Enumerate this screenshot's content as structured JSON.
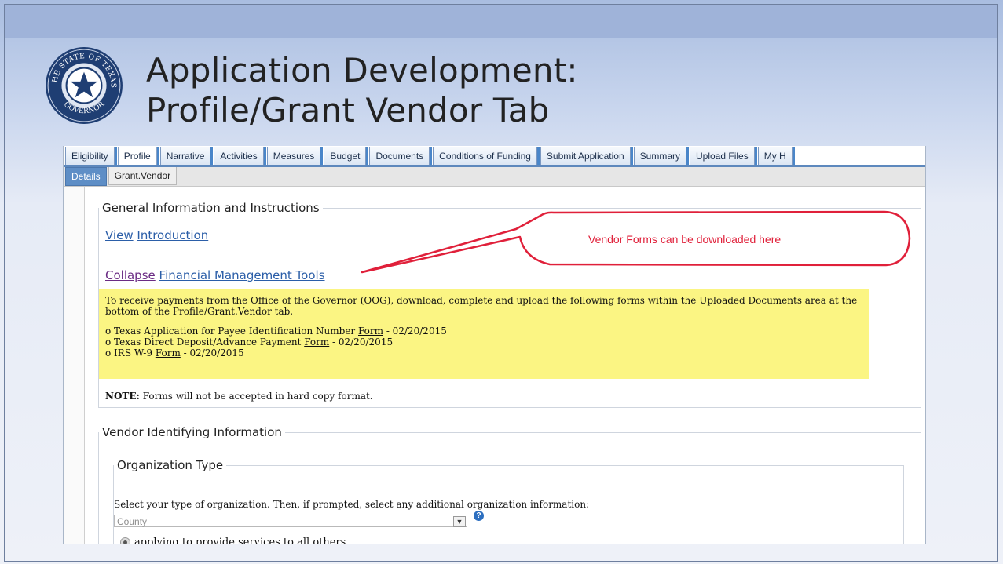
{
  "slide": {
    "title_line1": "Application Development:",
    "title_line2": "Profile/Grant Vendor Tab",
    "seal_text": "THE STATE OF TEXAS GOVERNOR"
  },
  "tabs": [
    "Eligibility",
    "Profile",
    "Narrative",
    "Activities",
    "Measures",
    "Budget",
    "Documents",
    "Conditions of Funding",
    "Submit Application",
    "Summary",
    "Upload Files",
    "My H"
  ],
  "active_tab": "Profile",
  "subtabs": [
    "Details",
    "Grant.Vendor"
  ],
  "active_subtab": "Grant.Vendor",
  "general": {
    "legend": "General Information and Instructions",
    "view_label": "View",
    "introduction_label": "Introduction",
    "collapse_label": "Collapse",
    "fmt_label": "Financial Management Tools",
    "instructions": "To receive payments from the Office of the Governor (OOG), download, complete and upload the following forms within the Uploaded Documents area at the bottom of the Profile/Grant.Vendor tab.",
    "forms": [
      {
        "prefix": "o Texas Application for Payee Identification Number ",
        "link": "Form",
        "suffix": " - 02/20/2015"
      },
      {
        "prefix": "o Texas Direct Deposit/Advance Payment ",
        "link": "Form",
        "suffix": " - 02/20/2015"
      },
      {
        "prefix": "o IRS W-9 ",
        "link": "Form",
        "suffix": " - 02/20/2015"
      }
    ],
    "note_label": "NOTE:",
    "note_text": " Forms will not be accepted in hard copy format."
  },
  "vendor": {
    "legend": "Vendor Identifying Information",
    "org_legend": "Organization Type",
    "org_instruction": "Select your type of organization. Then, if prompted, select any additional organization information:",
    "org_select_value": "County",
    "radio_label": "applying to provide services to all others"
  },
  "callout": {
    "text": "Vendor Forms can be downloaded here",
    "color": "#e0203a"
  },
  "colors": {
    "link": "#2b5ea8",
    "visited_link": "#6b2c84",
    "highlight": "#fbf583",
    "tab_accent": "#4a86c9"
  }
}
